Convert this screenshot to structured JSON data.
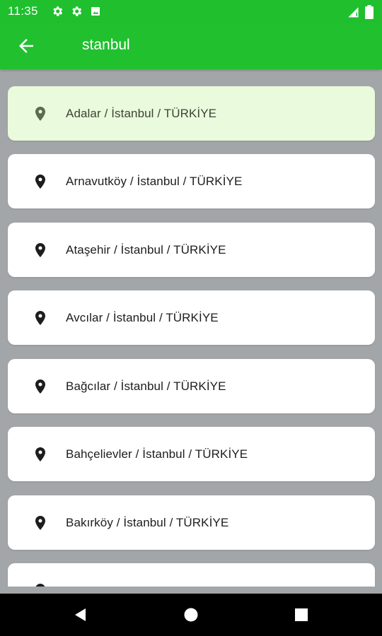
{
  "status_bar": {
    "time": "11:35",
    "icons": [
      "settings-icon",
      "settings-icon",
      "photo-icon"
    ],
    "right_icons": [
      "signal-icon",
      "battery-icon"
    ]
  },
  "app_bar": {
    "back_icon": "arrow-left-icon",
    "title": "stanbul",
    "color": "#21c02f"
  },
  "list": {
    "selected_index": 0,
    "selected_color": "#eafadc",
    "items": [
      {
        "label": "Adalar / İstanbul / TÜRKİYE",
        "icon": "location-pin-icon"
      },
      {
        "label": "Arnavutköy / İstanbul / TÜRKİYE",
        "icon": "location-pin-icon"
      },
      {
        "label": "Ataşehir / İstanbul / TÜRKİYE",
        "icon": "location-pin-icon"
      },
      {
        "label": "Avcılar / İstanbul / TÜRKİYE",
        "icon": "location-pin-icon"
      },
      {
        "label": "Bağcılar / İstanbul / TÜRKİYE",
        "icon": "location-pin-icon"
      },
      {
        "label": "Bahçelievler / İstanbul / TÜRKİYE",
        "icon": "location-pin-icon"
      },
      {
        "label": "Bakırköy / İstanbul / TÜRKİYE",
        "icon": "location-pin-icon"
      },
      {
        "label": "",
        "icon": "location-pin-icon"
      }
    ]
  },
  "nav_bar": {
    "buttons": [
      "back-triangle-icon",
      "home-circle-icon",
      "recents-square-icon"
    ]
  }
}
